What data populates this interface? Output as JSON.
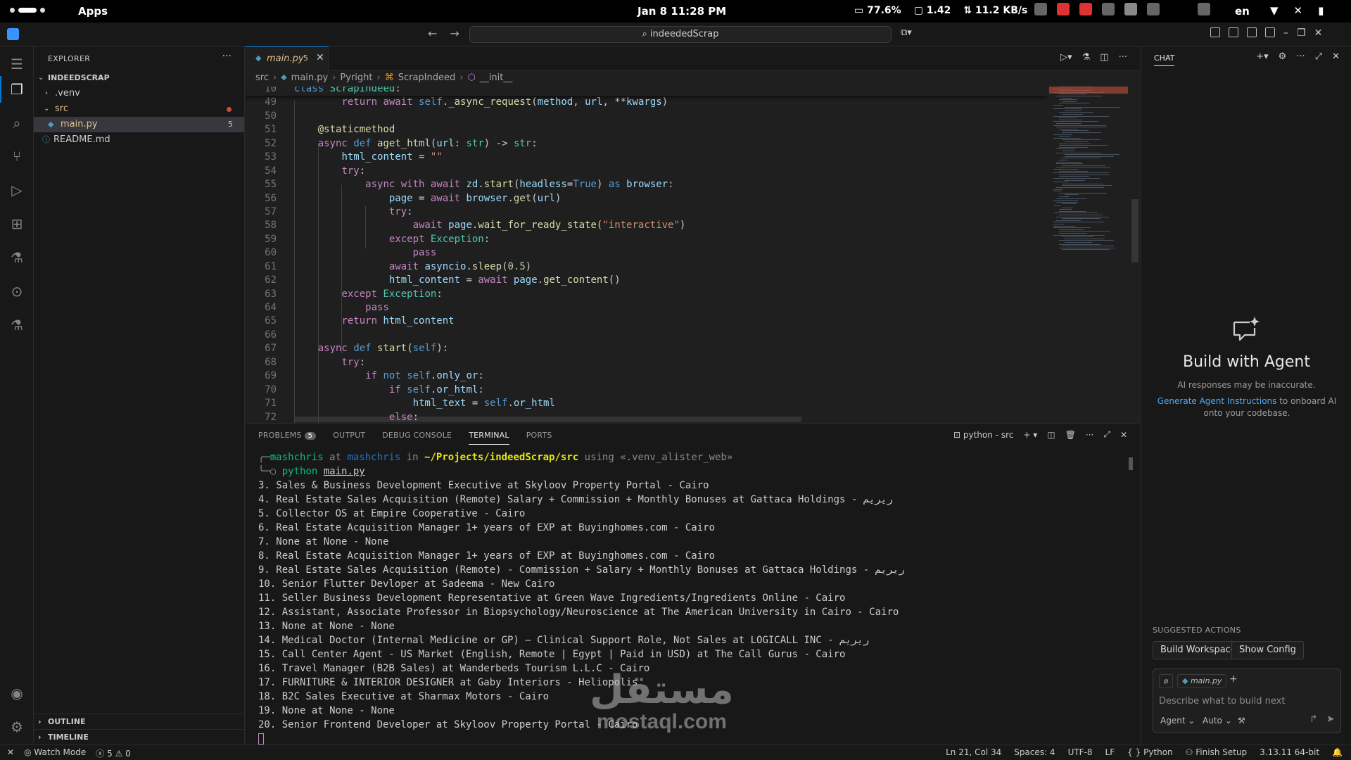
{
  "system_bar": {
    "apps_label": "Apps",
    "datetime": "Jan 8  11:28 PM",
    "battery": "77.6%",
    "load": "1.42",
    "net_speed": "11.2 KB/s",
    "lang": "en"
  },
  "window": {
    "command_center": "indeededScrap"
  },
  "explorer": {
    "header": "EXPLORER",
    "project": "INDEEDSCRAP",
    "items": [
      {
        "label": ".venv"
      },
      {
        "label": "src"
      },
      {
        "label": "main.py",
        "badge": "5"
      },
      {
        "label": "README.md"
      }
    ],
    "outline": "OUTLINE",
    "timeline": "TIMELINE"
  },
  "editor": {
    "tab_name": "main.py",
    "tab_badge": "5",
    "breadcrumbs": [
      "src",
      "main.py",
      "Pyright",
      "ScrapIndeed",
      "__init__"
    ]
  },
  "code_lines": [
    {
      "n": "10",
      "text": "class ScrapIndeed:"
    },
    {
      "n": "49",
      "text": "        return await self._async_request(method, url, **kwargs)"
    },
    {
      "n": "50",
      "text": ""
    },
    {
      "n": "51",
      "text": "    @staticmethod"
    },
    {
      "n": "52",
      "text": "    async def aget_html(url: str) -> str:"
    },
    {
      "n": "53",
      "text": "        html_content = \"\""
    },
    {
      "n": "54",
      "text": "        try:"
    },
    {
      "n": "55",
      "text": "            async with await zd.start(headless=True) as browser:"
    },
    {
      "n": "56",
      "text": "                page = await browser.get(url)"
    },
    {
      "n": "57",
      "text": "                try:"
    },
    {
      "n": "58",
      "text": "                    await page.wait_for_ready_state(\"interactive\")"
    },
    {
      "n": "59",
      "text": "                except Exception:"
    },
    {
      "n": "60",
      "text": "                    pass"
    },
    {
      "n": "61",
      "text": "                await asyncio.sleep(0.5)"
    },
    {
      "n": "62",
      "text": "                html_content = await page.get_content()"
    },
    {
      "n": "63",
      "text": "        except Exception:"
    },
    {
      "n": "64",
      "text": "            pass"
    },
    {
      "n": "65",
      "text": "        return html_content"
    },
    {
      "n": "66",
      "text": ""
    },
    {
      "n": "67",
      "text": "    async def start(self):"
    },
    {
      "n": "68",
      "text": "        try:"
    },
    {
      "n": "69",
      "text": "            if not self.only_or:"
    },
    {
      "n": "70",
      "text": "                if self.or_html:"
    },
    {
      "n": "71",
      "text": "                    html_text = self.or_html"
    },
    {
      "n": "72",
      "text": "                else:"
    }
  ],
  "panel": {
    "tabs": [
      "PROBLEMS",
      "OUTPUT",
      "DEBUG CONSOLE",
      "TERMINAL",
      "PORTS"
    ],
    "problems_count": "5",
    "terminal_name": "python - src"
  },
  "terminal": {
    "prompt_user": "mashchris",
    "prompt_at": "at",
    "prompt_host": "mashchris",
    "prompt_in": "in",
    "prompt_path": "~/Projects/indeedScrap/src",
    "prompt_using": "using «.venv_alister_web»",
    "cmd_python": "python",
    "cmd_file": "main.py",
    "lines": [
      "3. Sales & Business Development Executive at Skyloov Property Portal - Cairo",
      "4. Real Estate Sales Acquisition (Remote) Salary + Commission + Monthly Bonuses at Gattaca Holdings - ﺭﻳﺮﻳﻢ",
      "5. Collector OS at Empire Cooperative - Cairo",
      "6. Real Estate Acquisition Manager 1+ years of EXP at Buyinghomes.com - Cairo",
      "7. None at None - None",
      "8. Real Estate Acquisition Manager 1+ years of EXP at Buyinghomes.com - Cairo",
      "9. Real Estate Sales Acquisition (Remote) - Commission + Salary + Monthly Bonuses at Gattaca Holdings - ﺭﻳﺮﻳﻢ",
      "10. Senior Flutter Devloper at Sadeema - New Cairo",
      "11. Seller Business Development Representative at Green Wave Ingredients/Ingredients Online - Cairo",
      "12. Assistant, Associate Professor in Biopsychology/Neuroscience at The American University in Cairo - Cairo",
      "13. None at None - None",
      "14. Medical Doctor (Internal Medicine or GP) – Clinical Support Role, Not Sales at LOGICALL INC - ﺭﻳﺮﻳﻢ",
      "15. Call Center Agent - US Market (English, Remote | Egypt | Paid in USD) at The Call Gurus - Cairo",
      "16. Travel Manager (B2B Sales) at Wanderbeds Tourism L.L.C - Cairo",
      "17. FURNITURE & INTERIOR DESIGNER at Gaby Interiors - Heliopolis",
      "18. B2C Sales Executive at Sharmax Motors - Cairo",
      "19. None at None - None",
      "20. Senior Frontend Developer at Skyloov Property Portal - Cairo"
    ]
  },
  "watermark": {
    "arabic": "مستقل",
    "latin": "mostaql.com"
  },
  "chat": {
    "header": "CHAT",
    "title": "Build with Agent",
    "subtitle": "AI responses may be inaccurate.",
    "gen_link": "Generate Agent Instructions",
    "gen_rest": " to onboard AI onto your codebase.",
    "suggested_label": "SUGGESTED ACTIONS",
    "btn_build": "Build Workspace",
    "btn_config": "Show Config",
    "context_chip": "main.py",
    "placeholder": "Describe what to build next",
    "mode": "Agent",
    "model": "Auto"
  },
  "status": {
    "watch": "Watch Mode",
    "errors": "5",
    "warnings": "0",
    "position": "Ln 21, Col 34",
    "spaces": "Spaces: 4",
    "encoding": "UTF-8",
    "eol": "LF",
    "language": "Python",
    "finish": "Finish Setup",
    "interpreter": "3.13.11 64-bit"
  }
}
